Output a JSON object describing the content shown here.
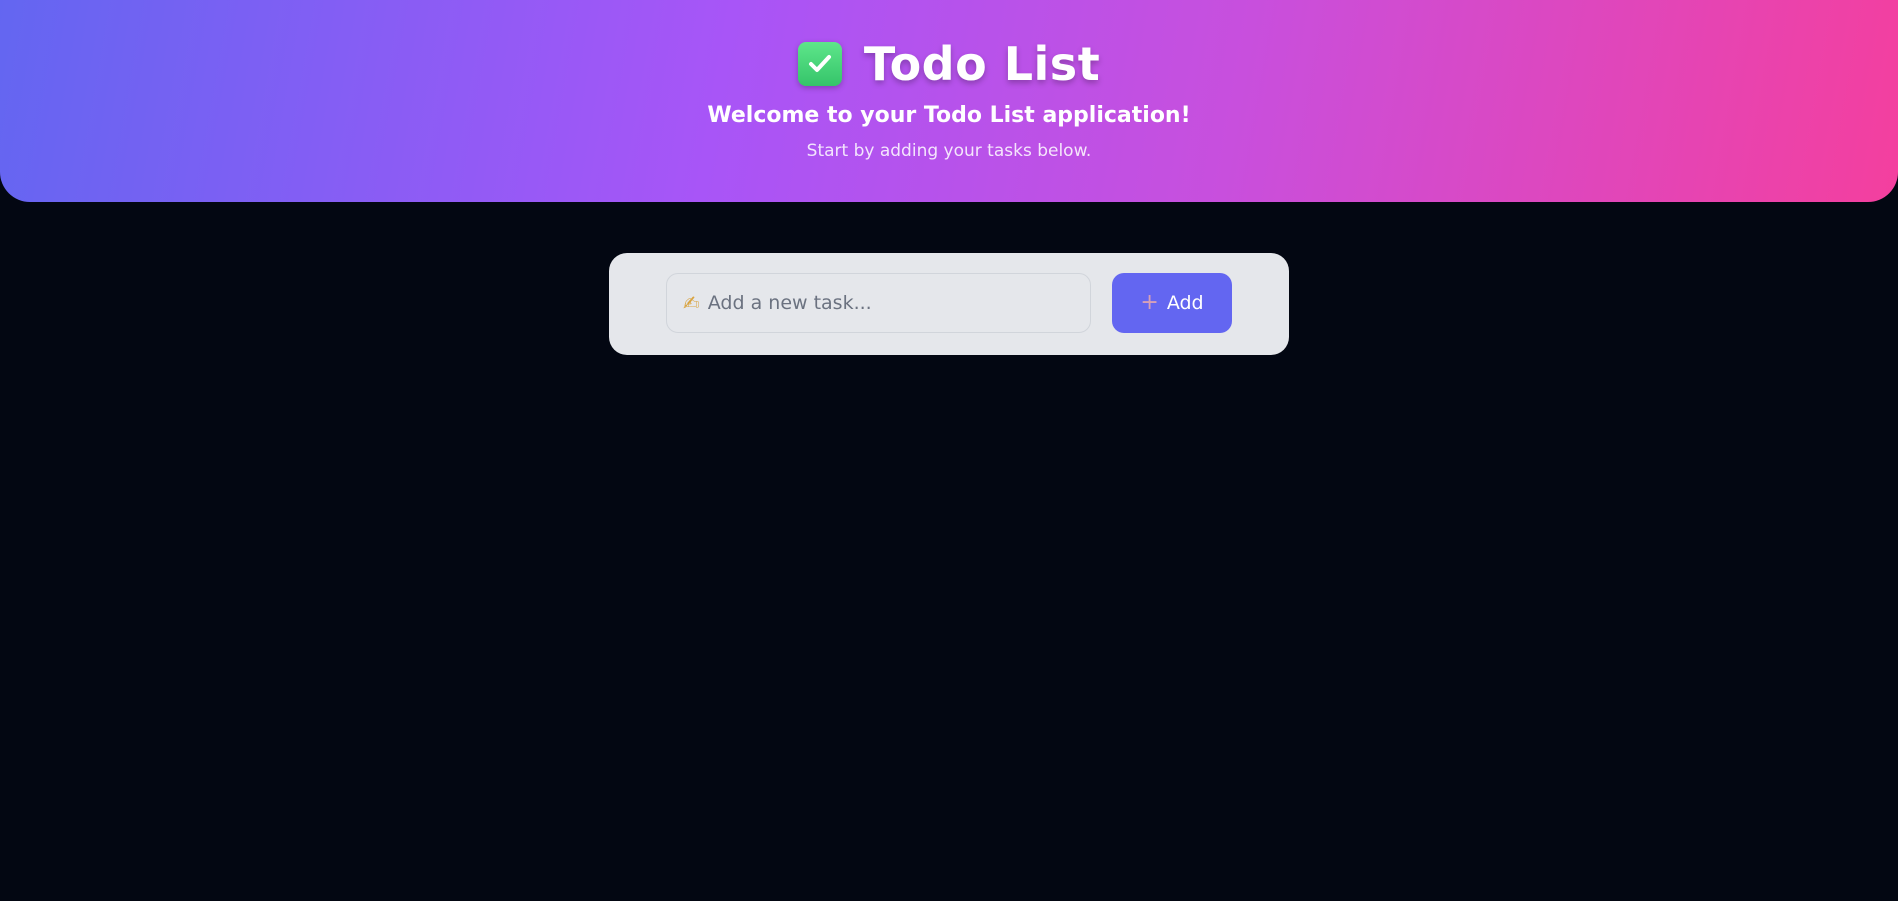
{
  "header": {
    "title": "Todo List",
    "welcome": "Welcome to your Todo List application!",
    "subtitle": "Start by adding your tasks below.",
    "title_icon": "check-mark-button-icon"
  },
  "task_form": {
    "input_value": "",
    "input_placeholder": "Add a new task...",
    "input_icon": "writing-hand-icon",
    "add_label": "Add",
    "add_icon": "plus-icon"
  },
  "colors": {
    "background": "#030712",
    "header_gradient_start": "#6366f1",
    "header_gradient_mid": "#a855f7",
    "header_gradient_end": "#f43f9e",
    "card": "#e5e7eb",
    "accent": "#6366f1",
    "check_green": "#35c46a"
  }
}
